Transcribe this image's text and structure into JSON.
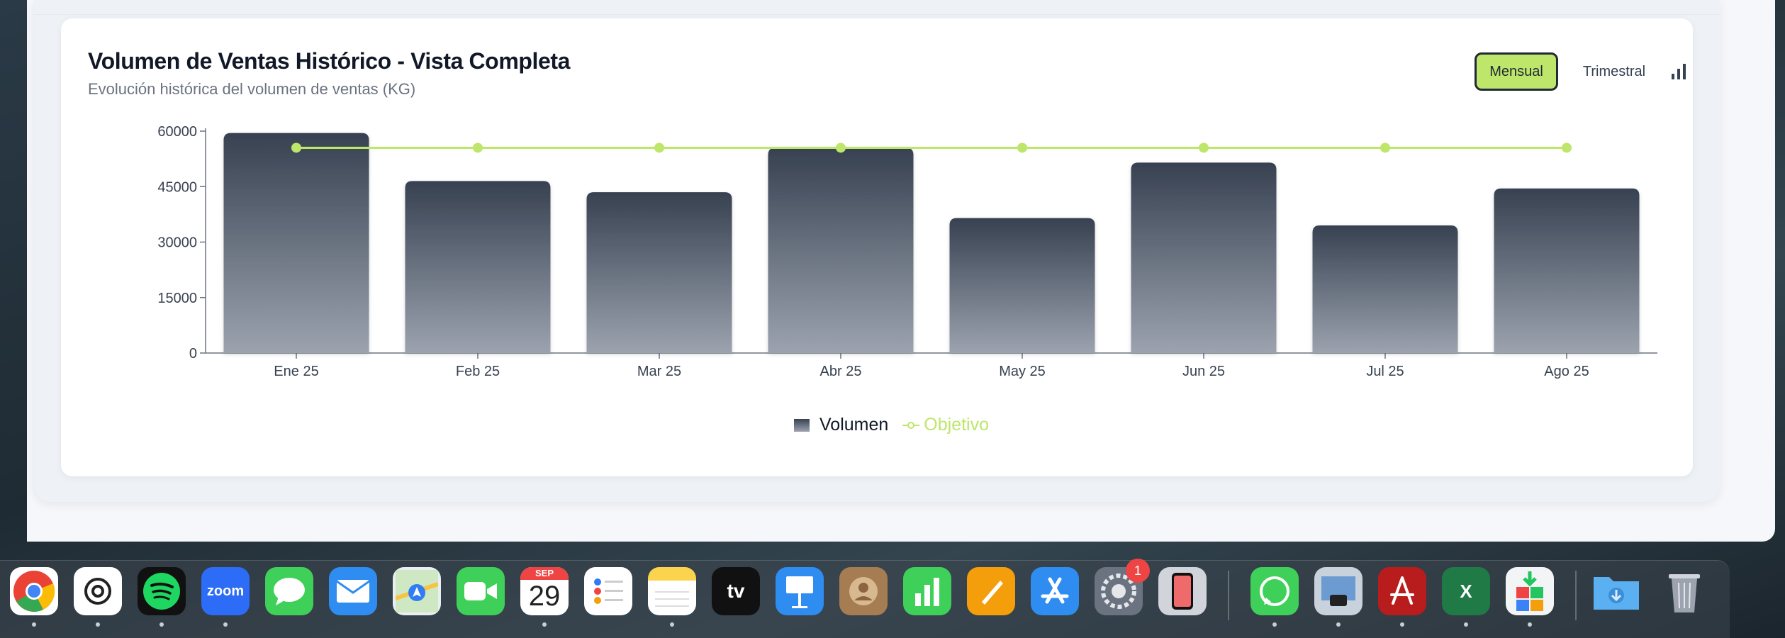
{
  "card": {
    "title": "Volumen de Ventas Histórico - Vista Completa",
    "subtitle": "Evolución histórica del volumen de ventas (KG)",
    "buttons": {
      "monthly": "Mensual",
      "quarterly": "Trimestral",
      "chart_toggle_icon": "bar-chart-icon"
    }
  },
  "chart_data": {
    "type": "bar",
    "categories": [
      "Ene 25",
      "Feb 25",
      "Mar 25",
      "Abr 25",
      "May 25",
      "Jun 25",
      "Jul 25",
      "Ago 25"
    ],
    "series": [
      {
        "name": "Volumen",
        "type": "bar",
        "values": [
          59500,
          46500,
          43500,
          55500,
          36500,
          51500,
          34500,
          44500
        ],
        "color": "#374151"
      },
      {
        "name": "Objetivo",
        "type": "line",
        "values": [
          55500,
          55500,
          55500,
          55500,
          55500,
          55500,
          55500,
          55500
        ],
        "color": "#bde66a"
      }
    ],
    "yticks": [
      0,
      15000,
      30000,
      45000,
      60000
    ],
    "ylim": [
      0,
      60000
    ],
    "grid": false,
    "legend": "bottom-center"
  },
  "legend": {
    "volumen": "Volumen",
    "objetivo": "Objetivo"
  },
  "dock": {
    "apps": [
      "Chrome",
      "ChatGPT",
      "Spotify",
      "Zoom",
      "Messages",
      "Mail",
      "Maps",
      "FaceTime",
      "Calendar",
      "Reminders",
      "Notes",
      "Apple TV",
      "Keynote",
      "Contacts",
      "Numbers",
      "Pages",
      "App Store",
      "System Settings",
      "iPhone Mirroring",
      "WhatsApp",
      "Preview",
      "Acrobat",
      "Excel",
      "Installer",
      "Downloads",
      "Trash"
    ],
    "zoom_label": "zoom",
    "calendar_month": "SEP",
    "calendar_day": "29",
    "tv_label": "tv",
    "excel_label": "X",
    "settings_badge": "1"
  },
  "colors": {
    "accent": "#bde66a",
    "bar": "#374151",
    "text": "#111827"
  }
}
